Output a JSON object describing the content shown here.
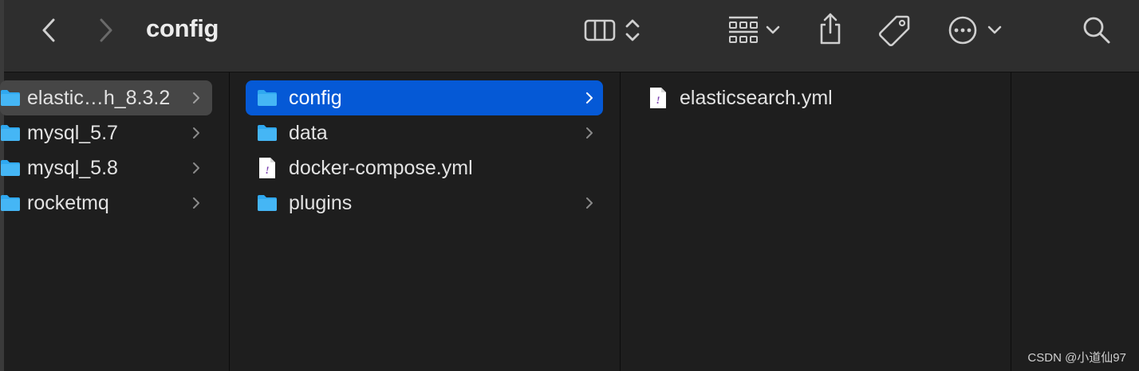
{
  "toolbar": {
    "title": "config",
    "buttons": {
      "back": "chevron-left-icon",
      "forward": "chevron-right-icon",
      "view": "column-view-icon",
      "group": "grid-group-icon",
      "share": "share-icon",
      "tags": "tag-icon",
      "more": "ellipsis-circle-icon",
      "search": "search-icon"
    }
  },
  "columns": [
    {
      "items": [
        {
          "label": "elastic…h_8.3.2",
          "type": "folder",
          "selected": "inactive"
        },
        {
          "label": "mysql_5.7",
          "type": "folder"
        },
        {
          "label": "mysql_5.8",
          "type": "folder"
        },
        {
          "label": "rocketmq",
          "type": "folder"
        }
      ]
    },
    {
      "items": [
        {
          "label": "config",
          "type": "folder",
          "selected": "active"
        },
        {
          "label": "data",
          "type": "folder"
        },
        {
          "label": "docker-compose.yml",
          "type": "file"
        },
        {
          "label": "plugins",
          "type": "folder"
        }
      ]
    },
    {
      "items": [
        {
          "label": "elasticsearch.yml",
          "type": "file"
        }
      ]
    }
  ],
  "watermark": "CSDN @小道仙97",
  "colors": {
    "toolbar_bg": "#2e2e2e",
    "column_bg": "#1e1e1e",
    "selection_active": "#0559d6",
    "selection_inactive": "#464646",
    "folder": "#2fa8f0"
  }
}
